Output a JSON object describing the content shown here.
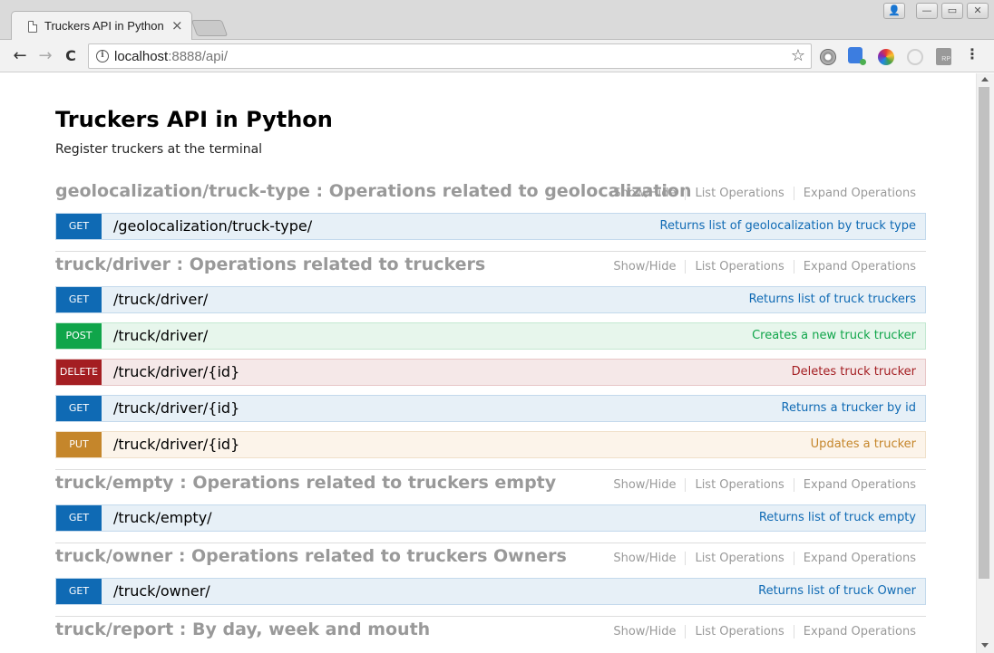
{
  "browser": {
    "tab_title": "Truckers API in Python",
    "tab_close": "×",
    "url_host": "localhost",
    "url_rest": ":8888/api/",
    "info_glyph": "i",
    "star_glyph": "☆",
    "menu_glyph": "⋮",
    "back_glyph": "←",
    "forward_glyph": "→",
    "reload_glyph": "C",
    "ext5_label": "RP",
    "win_user": "👤",
    "win_min": "—",
    "win_max": "▭",
    "win_close": "✕"
  },
  "api": {
    "title": "Truckers API in Python",
    "description": "Register truckers at the terminal"
  },
  "resource_links": {
    "show_hide": "Show/Hide",
    "list_operations": "List Operations",
    "expand_operations": "Expand Operations"
  },
  "resources": [
    {
      "title": "geolocalization/truck-type : Operations related to geolocalization",
      "operations": [
        {
          "method": "GET",
          "path": "/geolocalization/truck-type/",
          "summary": "Returns list of geolocalization by truck type"
        }
      ]
    },
    {
      "title": "truck/driver : Operations related to truckers",
      "operations": [
        {
          "method": "GET",
          "path": "/truck/driver/",
          "summary": "Returns list of truck truckers"
        },
        {
          "method": "POST",
          "path": "/truck/driver/",
          "summary": "Creates a new truck trucker"
        },
        {
          "method": "DELETE",
          "path": "/truck/driver/{id}",
          "summary": "Deletes truck trucker"
        },
        {
          "method": "GET",
          "path": "/truck/driver/{id}",
          "summary": "Returns a trucker by id"
        },
        {
          "method": "PUT",
          "path": "/truck/driver/{id}",
          "summary": "Updates a trucker"
        }
      ]
    },
    {
      "title": "truck/empty : Operations related to truckers empty",
      "operations": [
        {
          "method": "GET",
          "path": "/truck/empty/",
          "summary": "Returns list of truck empty"
        }
      ]
    },
    {
      "title": "truck/owner : Operations related to truckers Owners",
      "operations": [
        {
          "method": "GET",
          "path": "/truck/owner/",
          "summary": "Returns list of truck Owner"
        }
      ]
    },
    {
      "title": "truck/report : By day, week and mouth",
      "operations": []
    }
  ],
  "colors": {
    "get": "#0f6ab4",
    "post": "#10a54a",
    "delete": "#a41e22",
    "put": "#c5862b",
    "resource_title": "#999999"
  }
}
